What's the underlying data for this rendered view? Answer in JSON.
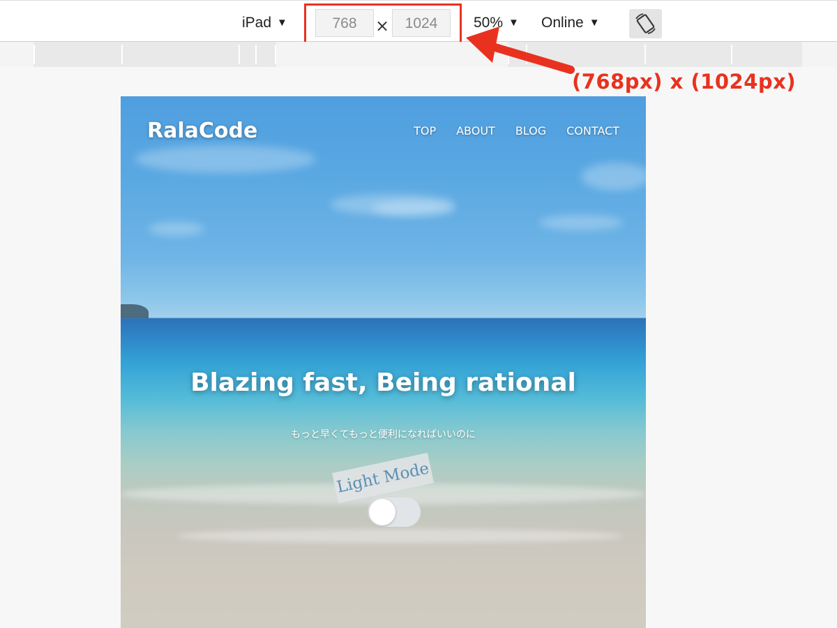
{
  "toolbar": {
    "device": "iPad",
    "width_value": "768",
    "height_value": "1024",
    "times_symbol": "×",
    "zoom": "50%",
    "network": "Online",
    "rotate_icon": "rotate-icon",
    "caret_icon": "▼"
  },
  "annotation": {
    "text": "(768px) x (1024px)",
    "color": "#e8321f"
  },
  "site": {
    "logo": "RalaCode",
    "nav": [
      "TOP",
      "ABOUT",
      "BLOG",
      "CONTACT"
    ],
    "hero_title": "Blazing fast, Being rational",
    "hero_subtitle": "もっと早くてもっと便利になればいいのに",
    "mode_label": "Light Mode"
  }
}
